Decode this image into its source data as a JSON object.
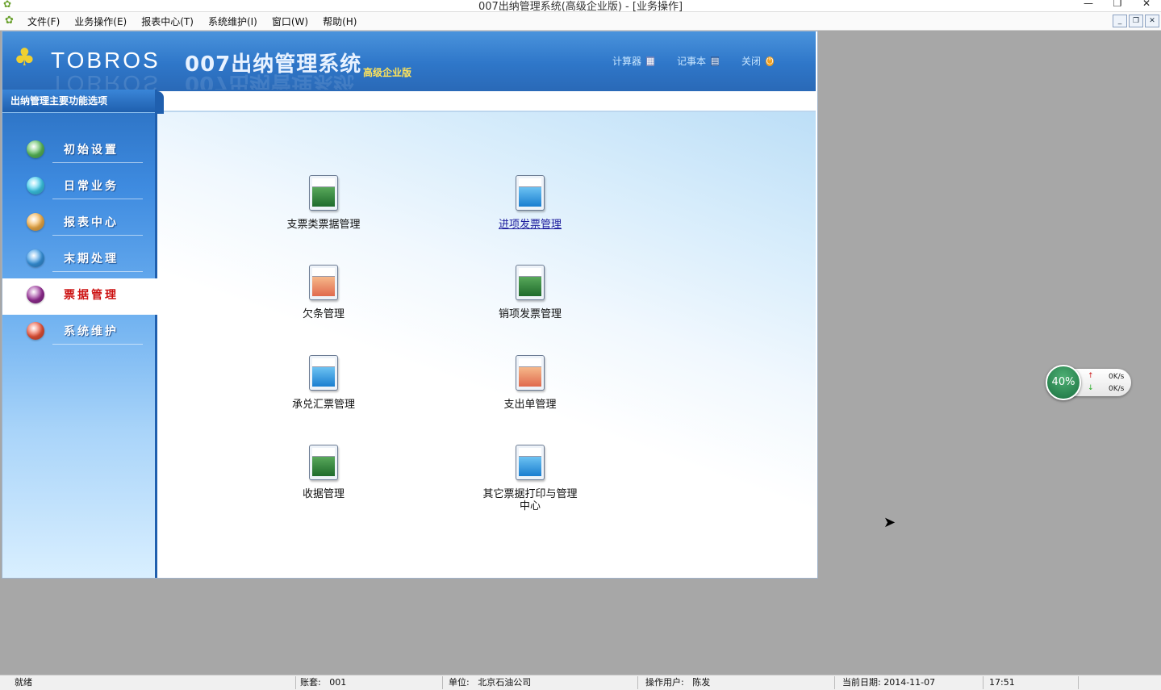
{
  "window": {
    "title": "007出纳管理系统(高级企业版) - [业务操作]"
  },
  "menu": [
    "文件(F)",
    "业务操作(E)",
    "报表中心(T)",
    "系统维护(I)",
    "窗口(W)",
    "帮助(H)"
  ],
  "header": {
    "logo_text": "TOBROS",
    "system_name": "007出纳管理系统",
    "edition": "高级企业版",
    "links": {
      "calculator": "计算器",
      "notepad": "记事本",
      "close": "关闭"
    }
  },
  "sidebar": {
    "title": "出纳管理主要功能选项",
    "items": [
      {
        "label": "初始设置",
        "color": "#5cc05c"
      },
      {
        "label": "日常业务",
        "color": "#3fd0f0"
      },
      {
        "label": "报表中心",
        "color": "#f6b24a"
      },
      {
        "label": "末期处理",
        "color": "#3a9be8"
      },
      {
        "label": "票据管理",
        "color": "#9a2f9a",
        "active": true
      },
      {
        "label": "系统维护",
        "color": "#f0553a"
      }
    ]
  },
  "tiles": [
    {
      "label": "支票类票据管理",
      "icon": "green-document-icon"
    },
    {
      "label": "进项发票管理",
      "icon": "blue-document-icon",
      "link": true
    },
    {
      "label": "欠条管理",
      "icon": "orange-document-icon"
    },
    {
      "label": "销项发票管理",
      "icon": "green-document-icon"
    },
    {
      "label": "承兑汇票管理",
      "icon": "blue-document-icon"
    },
    {
      "label": "支出单管理",
      "icon": "orange-document-icon"
    },
    {
      "label": "收据管理",
      "icon": "green-document-icon"
    },
    {
      "label": "其它票据打印与管理中心",
      "icon": "blue-document-icon"
    }
  ],
  "status": {
    "ready": "就绪",
    "account_label": "账套:",
    "account_value": "001",
    "unit_label": "单位:",
    "unit_value": "北京石油公司",
    "user_label": "操作用户:",
    "user_value": "陈发",
    "date_label": "当前日期:",
    "date_value": "2014-11-07",
    "time": "17:51"
  },
  "net_widget": {
    "percent": "40%",
    "up": "0K/s",
    "down": "0K/s"
  }
}
